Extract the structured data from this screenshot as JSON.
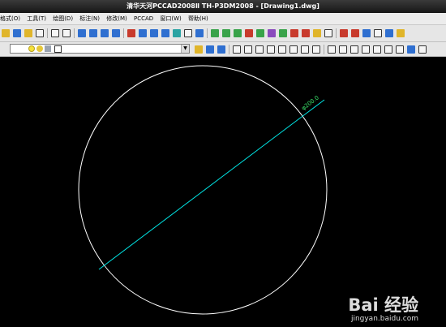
{
  "window": {
    "title": "清华天河PCCAD2008Ⅱ TH-P3DM2008 - [Drawing1.dwg]"
  },
  "menu": [
    "格式(O)",
    "工具(T)",
    "绘图(D)",
    "标注(N)",
    "修改(M)",
    "PCCAD",
    "窗口(W)",
    "帮助(H)"
  ],
  "drawing": {
    "dimension_text": "φ200.0",
    "circle_color": "#ffffff",
    "dimension_color": "#00e3e3",
    "dimension_text_color": "#39e26a"
  },
  "watermark": {
    "logo": "Bai 经验",
    "url": "jingyan.baidu.com"
  }
}
